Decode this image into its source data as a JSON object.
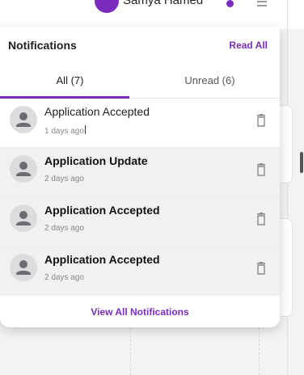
{
  "topbar": {
    "username": "Samya Hamed"
  },
  "panel": {
    "title": "Notifications",
    "read_all": "Read All",
    "tabs": [
      {
        "label": "All (7)",
        "active": true
      },
      {
        "label": "Unread (6)",
        "active": false
      }
    ],
    "items": [
      {
        "title": "Application Accepted",
        "time": "1 days ago",
        "read": true
      },
      {
        "title": "Application Update",
        "time": "2 days ago",
        "read": false
      },
      {
        "title": "Application Accepted",
        "time": "2 days ago",
        "read": false
      },
      {
        "title": "Application Accepted",
        "time": "2 days ago",
        "read": false
      }
    ],
    "view_all": "View All Notifications"
  },
  "colors": {
    "accent": "#7b2cbf",
    "unread_bg": "#f1f1f3",
    "avatar_bg": "#dcdcdf"
  },
  "icons": {
    "item_avatar": "person-icon",
    "item_action": "trash-icon"
  }
}
